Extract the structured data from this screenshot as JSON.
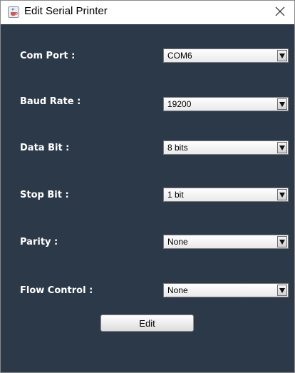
{
  "window": {
    "title": "Edit Serial Printer",
    "app_icon": "java-cup-icon",
    "close_icon": "close-icon"
  },
  "form": {
    "com_port": {
      "label": "Com Port :",
      "value": "COM6"
    },
    "baud_rate": {
      "label": "Baud Rate :",
      "value": "19200"
    },
    "data_bit": {
      "label": "Data Bit :",
      "value": "8 bits"
    },
    "stop_bit": {
      "label": "Stop Bit :",
      "value": "1 bit"
    },
    "parity": {
      "label": "Parity :",
      "value": "None"
    },
    "flow_control": {
      "label": "Flow Control :",
      "value": "None"
    }
  },
  "actions": {
    "edit_label": "Edit"
  },
  "colors": {
    "panel_background": "#2c3949",
    "label_text": "#ffffff"
  }
}
